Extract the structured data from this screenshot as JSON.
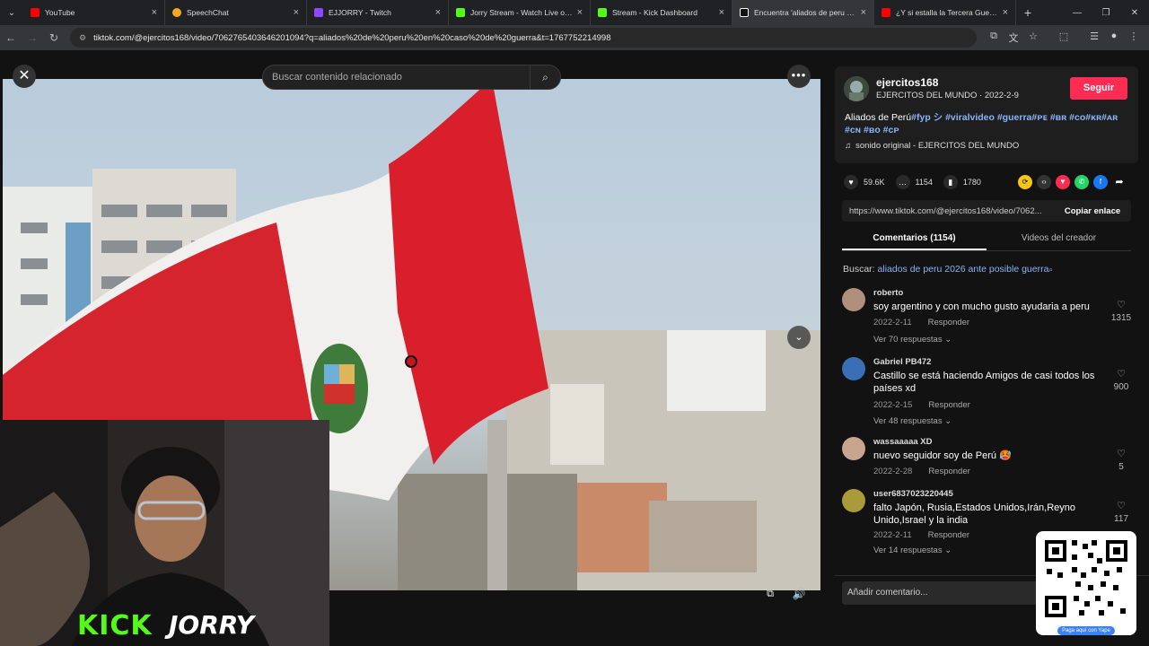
{
  "browser": {
    "tabs": [
      {
        "title": "YouTube",
        "color": "#ff0000"
      },
      {
        "title": "SpeechChat",
        "color": "#f5a623"
      },
      {
        "title": "EJJORRY - Twitch",
        "color": "#9146ff"
      },
      {
        "title": "Jorry Stream - Watch Live on Kick",
        "color": "#53fc18"
      },
      {
        "title": "Stream - Kick Dashboard",
        "color": "#53fc18"
      },
      {
        "title": "Encuentra 'aliados de peru en caso de guerra'",
        "color": "#ffffff"
      },
      {
        "title": "¿Y si estalla la Tercera Guerra Mundial?",
        "color": "#ff0000"
      }
    ],
    "url": "tiktok.com/@ejercitos168/video/7062765403646201094?q=aliados%20de%20peru%20en%20caso%20de%20guerra&t=1767752214998"
  },
  "video": {
    "search_placeholder": "Buscar contenido relacionado"
  },
  "stream_overlay": {
    "logo": "KICK",
    "name": "JORRY"
  },
  "author": {
    "username": "ejercitos168",
    "subtitle": "EJERCITOS DEL MUNDO · 2022-2-9",
    "follow_label": "Seguir",
    "description_text": "Aliados de Perú",
    "hashtags_line1": "#fyp シ #viralvideo #guerra#ᴘᴇ #ʙʀ #ᴄᴏ#ᴋʀ#ᴀʀ",
    "hashtags_line2": "#ᴄɴ #ʙᴏ #ᴄᴘ",
    "music": "sonido original - EJERCITOS DEL MUNDO"
  },
  "stats": {
    "likes": "59.6K",
    "comments": "1154",
    "saves": "1780"
  },
  "link": {
    "url": "https://www.tiktok.com/@ejercitos168/video/7062...",
    "copy_label": "Copiar enlace"
  },
  "panel_tabs": {
    "comments": "Comentarios (1154)",
    "creator": "Videos del creador"
  },
  "search_suggestion": {
    "prefix": "Buscar:",
    "query": "aliados de peru 2026 ante posible guerra"
  },
  "comments": [
    {
      "user": "roberto",
      "text": "soy argentino y con mucho gusto ayudaria a peru",
      "date": "2022-2-11",
      "reply": "Responder",
      "likes": "1315",
      "replies": "Ver 70 respuestas ⌄"
    },
    {
      "user": "Gabriel PB472",
      "text": "Castillo se está haciendo Amigos de casi todos los países xd",
      "date": "2022-2-15",
      "reply": "Responder",
      "likes": "900",
      "replies": "Ver 48 respuestas ⌄"
    },
    {
      "user": "wassaaaaa XD",
      "text": "nuevo seguidor soy de Perú 🥵",
      "date": "2022-2-28",
      "reply": "Responder",
      "likes": "5",
      "replies": ""
    },
    {
      "user": "user6837023220445",
      "text": "falto Japón, Rusia,Estados Unidos,Irán,Reyno Unido,Israel y la india",
      "date": "2022-2-11",
      "reply": "Responder",
      "likes": "117",
      "replies": "Ver 14 respuestas ⌄"
    }
  ],
  "add_comment_placeholder": "Añadir comentario...",
  "qr_label": "Paga aquí con Yape"
}
